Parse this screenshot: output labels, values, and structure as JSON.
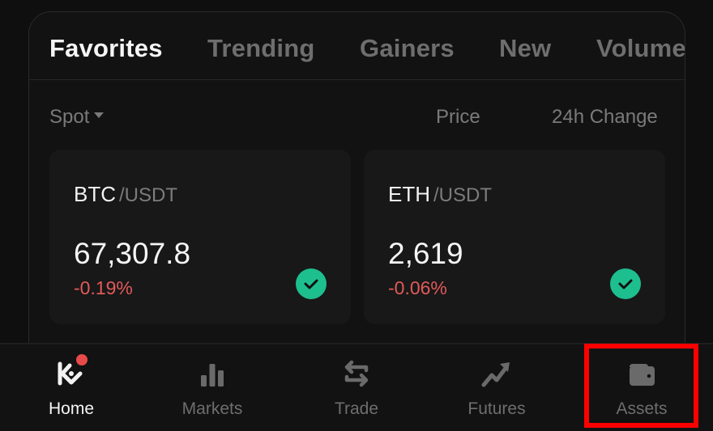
{
  "tabs": [
    {
      "label": "Favorites",
      "active": true
    },
    {
      "label": "Trending",
      "active": false
    },
    {
      "label": "Gainers",
      "active": false
    },
    {
      "label": "New",
      "active": false
    },
    {
      "label": "Volume",
      "active": false
    }
  ],
  "filter": {
    "label": "Spot",
    "icon": "caret-down-icon"
  },
  "columns": {
    "price": "Price",
    "change": "24h Change"
  },
  "cards": [
    {
      "base": "BTC",
      "quote": "/USDT",
      "price": "67,307.8",
      "change": "-0.19%",
      "selected": true,
      "icon": "check-circle-icon"
    },
    {
      "base": "ETH",
      "quote": "/USDT",
      "price": "2,619",
      "change": "-0.06%",
      "selected": true,
      "icon": "check-circle-icon"
    }
  ],
  "colors": {
    "negative": "#e35959",
    "check": "#1dbf8e",
    "notification": "#e84a4a",
    "highlight": "#ff0000"
  },
  "nav": [
    {
      "label": "Home",
      "icon": "kucoin-logo-icon",
      "active": true,
      "badge": true
    },
    {
      "label": "Markets",
      "icon": "bar-chart-icon",
      "active": false
    },
    {
      "label": "Trade",
      "icon": "swap-arrows-icon",
      "active": false
    },
    {
      "label": "Futures",
      "icon": "trend-up-icon",
      "active": false
    },
    {
      "label": "Assets",
      "icon": "wallet-icon",
      "active": false,
      "highlighted": true
    }
  ]
}
